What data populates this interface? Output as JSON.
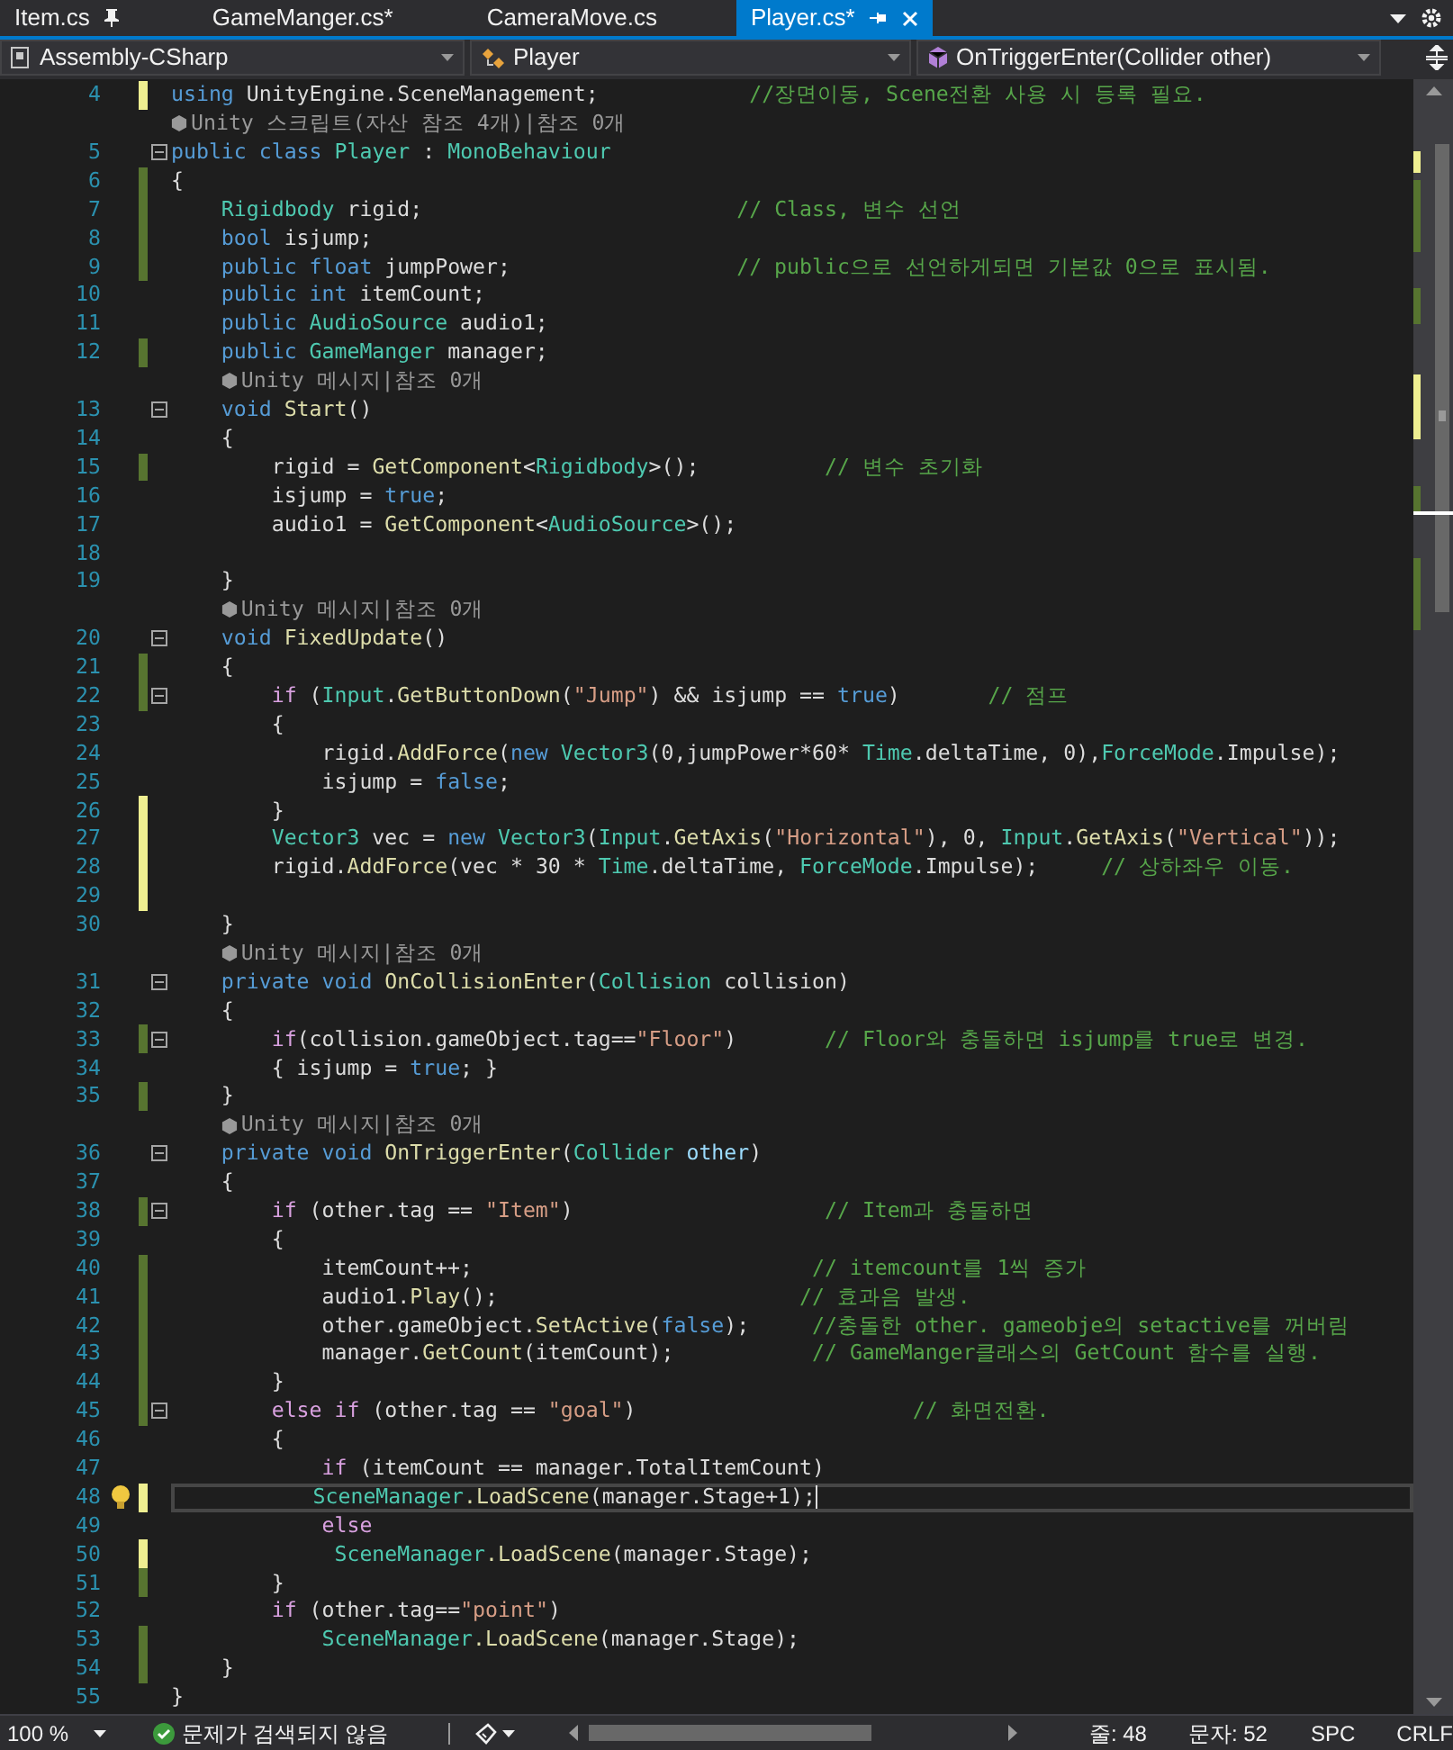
{
  "tabs": [
    {
      "label": "Item.cs",
      "selected": false,
      "pinned": true
    },
    {
      "label": "GameManger.cs*",
      "selected": false,
      "pinned": false
    },
    {
      "label": "CameraMove.cs",
      "selected": false,
      "pinned": false
    },
    {
      "label": "Player.cs*",
      "selected": true,
      "pinned": false
    }
  ],
  "navbar": [
    {
      "kind": "project",
      "label": "Assembly-CSharp"
    },
    {
      "kind": "class",
      "label": "Player"
    },
    {
      "kind": "member",
      "label": "OnTriggerEnter(Collider other)"
    }
  ],
  "rows": [
    {
      "kind": "code",
      "number": "4",
      "changed": true,
      "saved": false,
      "fold": false,
      "current": false,
      "tokens": [
        {
          "kind": "keyword",
          "text": "using"
        },
        {
          "kind": "plain",
          "text": " UnityEngine.SceneManagement;            "
        },
        {
          "kind": "comment",
          "text": "//장면이동, Scene전환 사용 시 등록 필요."
        }
      ]
    },
    {
      "kind": "lens",
      "text": "Unity 스크립트(자산 참조 4개)|참조 0개"
    },
    {
      "kind": "code",
      "number": "5",
      "changed": false,
      "fold": true,
      "current": false,
      "tokens": [
        {
          "kind": "keyword",
          "text": "public class "
        },
        {
          "kind": "type",
          "text": "Player"
        },
        {
          "kind": "plain",
          "text": " : "
        },
        {
          "kind": "type",
          "text": "MonoBehaviour"
        }
      ]
    },
    {
      "kind": "code",
      "number": "6",
      "changed": true,
      "saved": true,
      "fold": false,
      "current": false,
      "tokens": [
        {
          "kind": "plain",
          "text": "{"
        }
      ]
    },
    {
      "kind": "code",
      "number": "7",
      "changed": true,
      "saved": true,
      "fold": false,
      "current": false,
      "tokens": [
        {
          "kind": "type",
          "text": "    Rigidbody"
        },
        {
          "kind": "plain",
          "text": " rigid;                         "
        },
        {
          "kind": "comment",
          "text": "// Class, 변수 선언"
        }
      ]
    },
    {
      "kind": "code",
      "number": "8",
      "changed": true,
      "saved": true,
      "fold": false,
      "current": false,
      "tokens": [
        {
          "kind": "keyword",
          "text": "    bool"
        },
        {
          "kind": "plain",
          "text": " isjump;"
        }
      ]
    },
    {
      "kind": "code",
      "number": "9",
      "changed": true,
      "saved": true,
      "fold": false,
      "current": false,
      "tokens": [
        {
          "kind": "keyword",
          "text": "    public float"
        },
        {
          "kind": "plain",
          "text": " jumpPower;                  "
        },
        {
          "kind": "comment",
          "text": "// public으로 선언하게되면 기본값 0으로 표시됨."
        }
      ]
    },
    {
      "kind": "code",
      "number": "10",
      "changed": false,
      "fold": false,
      "current": false,
      "tokens": [
        {
          "kind": "keyword",
          "text": "    public int"
        },
        {
          "kind": "plain",
          "text": " itemCount;"
        }
      ]
    },
    {
      "kind": "code",
      "number": "11",
      "changed": false,
      "fold": false,
      "current": false,
      "tokens": [
        {
          "kind": "keyword",
          "text": "    public "
        },
        {
          "kind": "type",
          "text": "AudioSource"
        },
        {
          "kind": "plain",
          "text": " audio1;"
        }
      ]
    },
    {
      "kind": "code",
      "number": "12",
      "changed": true,
      "saved": true,
      "fold": false,
      "current": false,
      "tokens": [
        {
          "kind": "keyword",
          "text": "    public "
        },
        {
          "kind": "type",
          "text": "GameManger"
        },
        {
          "kind": "plain",
          "text": " manager;"
        }
      ]
    },
    {
      "kind": "lens",
      "text": "Unity 메시지|참조 0개"
    },
    {
      "kind": "code",
      "number": "13",
      "changed": false,
      "fold": true,
      "current": false,
      "tokens": [
        {
          "kind": "keyword",
          "text": "    void "
        },
        {
          "kind": "method",
          "text": "Start"
        },
        {
          "kind": "plain",
          "text": "()"
        }
      ]
    },
    {
      "kind": "code",
      "number": "14",
      "changed": false,
      "fold": false,
      "current": false,
      "tokens": [
        {
          "kind": "plain",
          "text": "    {"
        }
      ]
    },
    {
      "kind": "code",
      "number": "15",
      "changed": true,
      "saved": true,
      "fold": false,
      "current": false,
      "tokens": [
        {
          "kind": "plain",
          "text": "        rigid = "
        },
        {
          "kind": "method",
          "text": "GetComponent"
        },
        {
          "kind": "plain",
          "text": "<"
        },
        {
          "kind": "type",
          "text": "Rigidbody"
        },
        {
          "kind": "plain",
          "text": ">();          "
        },
        {
          "kind": "comment",
          "text": "// 변수 초기화"
        }
      ]
    },
    {
      "kind": "code",
      "number": "16",
      "changed": false,
      "fold": false,
      "current": false,
      "tokens": [
        {
          "kind": "plain",
          "text": "        isjump = "
        },
        {
          "kind": "keyword",
          "text": "true"
        },
        {
          "kind": "plain",
          "text": ";"
        }
      ]
    },
    {
      "kind": "code",
      "number": "17",
      "changed": false,
      "fold": false,
      "current": false,
      "tokens": [
        {
          "kind": "plain",
          "text": "        audio1 = "
        },
        {
          "kind": "method",
          "text": "GetComponent"
        },
        {
          "kind": "plain",
          "text": "<"
        },
        {
          "kind": "type",
          "text": "AudioSource"
        },
        {
          "kind": "plain",
          "text": ">();"
        }
      ]
    },
    {
      "kind": "code",
      "number": "18",
      "changed": false,
      "fold": false,
      "current": false
    },
    {
      "kind": "code",
      "number": "19",
      "changed": false,
      "fold": false,
      "current": false,
      "tokens": [
        {
          "kind": "plain",
          "text": "    }"
        }
      ]
    },
    {
      "kind": "lens",
      "text": "Unity 메시지|참조 0개"
    },
    {
      "kind": "code",
      "number": "20",
      "changed": false,
      "fold": true,
      "current": false,
      "tokens": [
        {
          "kind": "keyword",
          "text": "    void "
        },
        {
          "kind": "method",
          "text": "FixedUpdate"
        },
        {
          "kind": "plain",
          "text": "()"
        }
      ]
    },
    {
      "kind": "code",
      "number": "21",
      "changed": true,
      "saved": true,
      "fold": false,
      "current": false,
      "tokens": [
        {
          "kind": "plain",
          "text": "    {"
        }
      ]
    },
    {
      "kind": "code",
      "number": "22",
      "changed": true,
      "saved": true,
      "fold": true,
      "current": false,
      "tokens": [
        {
          "kind": "control",
          "text": "        if"
        },
        {
          "kind": "plain",
          "text": " ("
        },
        {
          "kind": "type",
          "text": "Input"
        },
        {
          "kind": "plain",
          "text": "."
        },
        {
          "kind": "method",
          "text": "GetButtonDown"
        },
        {
          "kind": "plain",
          "text": "("
        },
        {
          "kind": "string",
          "text": "\"Jump\""
        },
        {
          "kind": "plain",
          "text": ") && isjump == "
        },
        {
          "kind": "keyword",
          "text": "true"
        },
        {
          "kind": "plain",
          "text": ")       "
        },
        {
          "kind": "comment",
          "text": "// 점프"
        }
      ]
    },
    {
      "kind": "code",
      "number": "23",
      "changed": false,
      "fold": false,
      "current": false,
      "tokens": [
        {
          "kind": "plain",
          "text": "        {"
        }
      ]
    },
    {
      "kind": "code",
      "number": "24",
      "changed": false,
      "fold": false,
      "current": false,
      "tokens": [
        {
          "kind": "plain",
          "text": "            rigid."
        },
        {
          "kind": "method",
          "text": "AddForce"
        },
        {
          "kind": "plain",
          "text": "("
        },
        {
          "kind": "keyword",
          "text": "new "
        },
        {
          "kind": "type",
          "text": "Vector3"
        },
        {
          "kind": "plain",
          "text": "(0,jumpPower*60* "
        },
        {
          "kind": "type",
          "text": "Time"
        },
        {
          "kind": "plain",
          "text": ".deltaTime, 0),"
        },
        {
          "kind": "type",
          "text": "ForceMode"
        },
        {
          "kind": "plain",
          "text": ".Impulse);"
        }
      ]
    },
    {
      "kind": "code",
      "number": "25",
      "changed": false,
      "fold": false,
      "current": false,
      "tokens": [
        {
          "kind": "plain",
          "text": "            isjump = "
        },
        {
          "kind": "keyword",
          "text": "false"
        },
        {
          "kind": "plain",
          "text": ";"
        }
      ]
    },
    {
      "kind": "code",
      "number": "26",
      "changed": true,
      "saved": false,
      "fold": false,
      "current": false,
      "tokens": [
        {
          "kind": "plain",
          "text": "        }"
        }
      ]
    },
    {
      "kind": "code",
      "number": "27",
      "changed": true,
      "saved": false,
      "fold": false,
      "current": false,
      "tokens": [
        {
          "kind": "type",
          "text": "        Vector3"
        },
        {
          "kind": "plain",
          "text": " vec = "
        },
        {
          "kind": "keyword",
          "text": "new "
        },
        {
          "kind": "type",
          "text": "Vector3"
        },
        {
          "kind": "plain",
          "text": "("
        },
        {
          "kind": "type",
          "text": "Input"
        },
        {
          "kind": "plain",
          "text": "."
        },
        {
          "kind": "method",
          "text": "GetAxis"
        },
        {
          "kind": "plain",
          "text": "("
        },
        {
          "kind": "string",
          "text": "\"Horizontal\""
        },
        {
          "kind": "plain",
          "text": "), 0, "
        },
        {
          "kind": "type",
          "text": "Input"
        },
        {
          "kind": "plain",
          "text": "."
        },
        {
          "kind": "method",
          "text": "GetAxis"
        },
        {
          "kind": "plain",
          "text": "("
        },
        {
          "kind": "string",
          "text": "\"Vertical\""
        },
        {
          "kind": "plain",
          "text": "));"
        }
      ]
    },
    {
      "kind": "code",
      "number": "28",
      "changed": true,
      "saved": false,
      "fold": false,
      "current": false,
      "tokens": [
        {
          "kind": "plain",
          "text": "        rigid."
        },
        {
          "kind": "method",
          "text": "AddForce"
        },
        {
          "kind": "plain",
          "text": "(vec * 30 * "
        },
        {
          "kind": "type",
          "text": "Time"
        },
        {
          "kind": "plain",
          "text": ".deltaTime, "
        },
        {
          "kind": "type",
          "text": "ForceMode"
        },
        {
          "kind": "plain",
          "text": ".Impulse);     "
        },
        {
          "kind": "comment",
          "text": "// 상하좌우 이동."
        }
      ]
    },
    {
      "kind": "code",
      "number": "29",
      "changed": true,
      "saved": false,
      "fold": false,
      "current": false
    },
    {
      "kind": "code",
      "number": "30",
      "changed": false,
      "fold": false,
      "current": false,
      "tokens": [
        {
          "kind": "plain",
          "text": "    }"
        }
      ]
    },
    {
      "kind": "lens",
      "text": "Unity 메시지|참조 0개"
    },
    {
      "kind": "code",
      "number": "31",
      "changed": false,
      "fold": true,
      "current": false,
      "tokens": [
        {
          "kind": "keyword",
          "text": "    private void "
        },
        {
          "kind": "method",
          "text": "OnCollisionEnter"
        },
        {
          "kind": "plain",
          "text": "("
        },
        {
          "kind": "type",
          "text": "Collision"
        },
        {
          "kind": "plain",
          "text": " collision)"
        }
      ]
    },
    {
      "kind": "code",
      "number": "32",
      "changed": false,
      "fold": false,
      "current": false,
      "tokens": [
        {
          "kind": "plain",
          "text": "    {"
        }
      ]
    },
    {
      "kind": "code",
      "number": "33",
      "changed": true,
      "saved": true,
      "fold": true,
      "current": false,
      "tokens": [
        {
          "kind": "control",
          "text": "        if"
        },
        {
          "kind": "plain",
          "text": "(collision.gameObject.tag=="
        },
        {
          "kind": "string",
          "text": "\"Floor\""
        },
        {
          "kind": "plain",
          "text": ")       "
        },
        {
          "kind": "comment",
          "text": "// Floor와 충돌하면 isjump를 true로 변경."
        }
      ]
    },
    {
      "kind": "code",
      "number": "34",
      "changed": false,
      "fold": false,
      "current": false,
      "tokens": [
        {
          "kind": "plain",
          "text": "        { isjump = "
        },
        {
          "kind": "keyword",
          "text": "true"
        },
        {
          "kind": "plain",
          "text": "; }"
        }
      ]
    },
    {
      "kind": "code",
      "number": "35",
      "changed": true,
      "saved": true,
      "fold": false,
      "current": false,
      "tokens": [
        {
          "kind": "plain",
          "text": "    }"
        }
      ]
    },
    {
      "kind": "lens",
      "text": "Unity 메시지|참조 0개"
    },
    {
      "kind": "code",
      "number": "36",
      "changed": false,
      "fold": true,
      "current": false,
      "tokens": [
        {
          "kind": "keyword",
          "text": "    private void "
        },
        {
          "kind": "method",
          "text": "OnTriggerEnter"
        },
        {
          "kind": "plain",
          "text": "("
        },
        {
          "kind": "type",
          "text": "Collider"
        },
        {
          "kind": "param",
          "text": " other"
        },
        {
          "kind": "plain",
          "text": ")"
        }
      ]
    },
    {
      "kind": "code",
      "number": "37",
      "changed": false,
      "fold": false,
      "current": false,
      "tokens": [
        {
          "kind": "plain",
          "text": "    {"
        }
      ]
    },
    {
      "kind": "code",
      "number": "38",
      "changed": true,
      "saved": true,
      "fold": true,
      "current": false,
      "tokens": [
        {
          "kind": "control",
          "text": "        if"
        },
        {
          "kind": "plain",
          "text": " (other.tag == "
        },
        {
          "kind": "string",
          "text": "\"Item\""
        },
        {
          "kind": "plain",
          "text": ")                    "
        },
        {
          "kind": "comment",
          "text": "// Item과 충돌하면"
        }
      ]
    },
    {
      "kind": "code",
      "number": "39",
      "changed": false,
      "fold": false,
      "current": false,
      "tokens": [
        {
          "kind": "plain",
          "text": "        {"
        }
      ]
    },
    {
      "kind": "code",
      "number": "40",
      "changed": true,
      "saved": true,
      "fold": false,
      "current": false,
      "tokens": [
        {
          "kind": "plain",
          "text": "            itemCount++;                           "
        },
        {
          "kind": "comment",
          "text": "// itemcount를 1씩 증가"
        }
      ]
    },
    {
      "kind": "code",
      "number": "41",
      "changed": true,
      "saved": true,
      "fold": false,
      "current": false,
      "tokens": [
        {
          "kind": "plain",
          "text": "            audio1."
        },
        {
          "kind": "method",
          "text": "Play"
        },
        {
          "kind": "plain",
          "text": "();                        "
        },
        {
          "kind": "comment",
          "text": "// 효과음 발생."
        }
      ]
    },
    {
      "kind": "code",
      "number": "42",
      "changed": true,
      "saved": true,
      "fold": false,
      "current": false,
      "tokens": [
        {
          "kind": "plain",
          "text": "            other.gameObject."
        },
        {
          "kind": "method",
          "text": "SetActive"
        },
        {
          "kind": "plain",
          "text": "("
        },
        {
          "kind": "keyword",
          "text": "false"
        },
        {
          "kind": "plain",
          "text": ");     "
        },
        {
          "kind": "comment",
          "text": "//충돌한 other. gameobje의 setactive를 꺼버림"
        }
      ]
    },
    {
      "kind": "code",
      "number": "43",
      "changed": true,
      "saved": true,
      "fold": false,
      "current": false,
      "tokens": [
        {
          "kind": "plain",
          "text": "            manager."
        },
        {
          "kind": "method",
          "text": "GetCount"
        },
        {
          "kind": "plain",
          "text": "(itemCount);           "
        },
        {
          "kind": "comment",
          "text": "// GameManger클래스의 GetCount 함수를 실행."
        }
      ]
    },
    {
      "kind": "code",
      "number": "44",
      "changed": true,
      "saved": true,
      "fold": false,
      "current": false,
      "tokens": [
        {
          "kind": "plain",
          "text": "        }"
        }
      ]
    },
    {
      "kind": "code",
      "number": "45",
      "changed": true,
      "saved": true,
      "fold": true,
      "current": false,
      "tokens": [
        {
          "kind": "control",
          "text": "        else if"
        },
        {
          "kind": "plain",
          "text": " (other.tag == "
        },
        {
          "kind": "string",
          "text": "\"goal\""
        },
        {
          "kind": "plain",
          "text": ")                      "
        },
        {
          "kind": "comment",
          "text": "// 화면전환."
        }
      ]
    },
    {
      "kind": "code",
      "number": "46",
      "changed": false,
      "fold": false,
      "current": false,
      "tokens": [
        {
          "kind": "plain",
          "text": "        {"
        }
      ]
    },
    {
      "kind": "code",
      "number": "47",
      "changed": false,
      "fold": false,
      "current": false,
      "tokens": [
        {
          "kind": "control",
          "text": "            if"
        },
        {
          "kind": "plain",
          "text": " (itemCount == manager.TotalItemCount)"
        }
      ]
    },
    {
      "kind": "code",
      "number": "48",
      "changed": true,
      "saved": false,
      "fold": false,
      "current": true,
      "tokens": [
        {
          "kind": "type",
          "text": "           SceneManager"
        },
        {
          "kind": "method",
          "text": ".LoadScene"
        },
        {
          "kind": "plain",
          "text": "(manager.Stage+1);"
        }
      ]
    },
    {
      "kind": "code",
      "number": "49",
      "changed": false,
      "fold": false,
      "current": false,
      "tokens": [
        {
          "kind": "control",
          "text": "            else"
        }
      ]
    },
    {
      "kind": "code",
      "number": "50",
      "changed": true,
      "saved": false,
      "fold": false,
      "current": false,
      "tokens": [
        {
          "kind": "type",
          "text": "             SceneManager"
        },
        {
          "kind": "method",
          "text": ".LoadScene"
        },
        {
          "kind": "plain",
          "text": "(manager.Stage);"
        }
      ]
    },
    {
      "kind": "code",
      "number": "51",
      "changed": true,
      "saved": true,
      "fold": false,
      "current": false,
      "tokens": [
        {
          "kind": "plain",
          "text": "        }"
        }
      ]
    },
    {
      "kind": "code",
      "number": "52",
      "changed": false,
      "fold": false,
      "current": false,
      "tokens": [
        {
          "kind": "control",
          "text": "        if"
        },
        {
          "kind": "plain",
          "text": " (other.tag=="
        },
        {
          "kind": "string",
          "text": "\"point\""
        },
        {
          "kind": "plain",
          "text": ")"
        }
      ]
    },
    {
      "kind": "code",
      "number": "53",
      "changed": true,
      "saved": true,
      "fold": false,
      "current": false,
      "tokens": [
        {
          "kind": "type",
          "text": "            SceneManager"
        },
        {
          "kind": "method",
          "text": ".LoadScene"
        },
        {
          "kind": "plain",
          "text": "(manager.Stage);"
        }
      ]
    },
    {
      "kind": "code",
      "number": "54",
      "changed": true,
      "saved": true,
      "fold": false,
      "current": false,
      "tokens": [
        {
          "kind": "plain",
          "text": "    }"
        }
      ]
    },
    {
      "kind": "code",
      "number": "55",
      "changed": false,
      "fold": false,
      "current": false,
      "tokens": [
        {
          "kind": "plain",
          "text": "}"
        }
      ]
    }
  ],
  "status_bar": {
    "zoom": "100 %",
    "issues": "문제가 검색되지 않음",
    "line": "줄: 48",
    "column": "문자: 52",
    "indent": "SPC",
    "line_ending": "CRLF"
  }
}
